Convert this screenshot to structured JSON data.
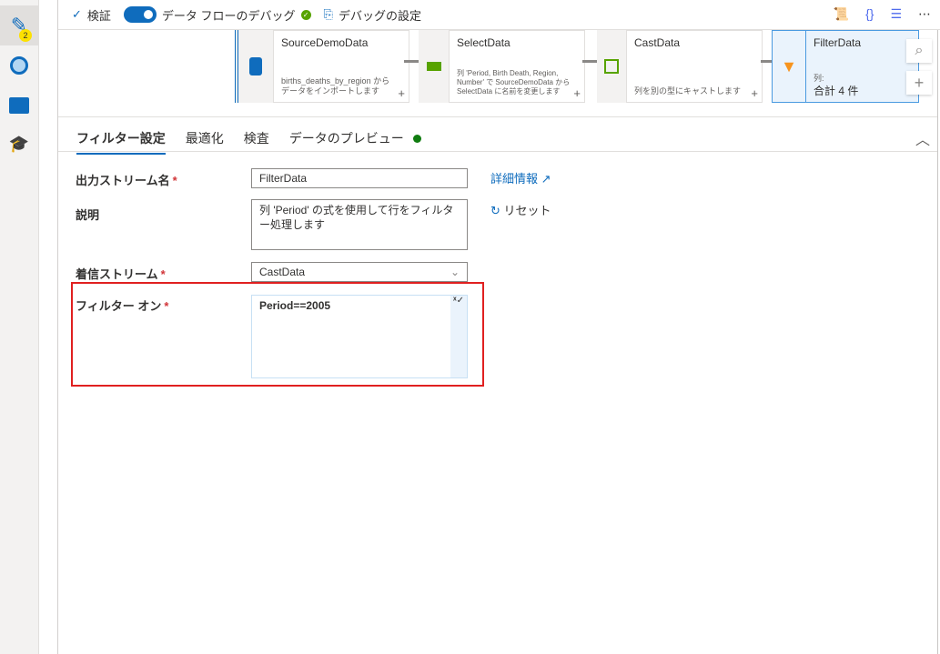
{
  "sidebar": {
    "items": [
      {
        "name": "author",
        "badge": "2"
      },
      {
        "name": "monitor"
      },
      {
        "name": "manage"
      },
      {
        "name": "learn"
      }
    ]
  },
  "toolbar": {
    "validate": "検証",
    "debug_label": "データ フローのデバッグ",
    "debug_on": true,
    "debug_settings": "デバッグの設定"
  },
  "nodes": [
    {
      "title": "SourceDemoData",
      "desc": "births_deaths_by_region からデータをインポートします"
    },
    {
      "title": "SelectData",
      "desc": "列 'Period, Birth Death, Region, Number' で SourceDemoData から SelectData に名前を変更します"
    },
    {
      "title": "CastData",
      "desc": "列を別の型にキャストします"
    },
    {
      "title": "FilterData",
      "desc_label": "列:",
      "desc": "合計 4 件"
    }
  ],
  "tabs": [
    "フィルター設定",
    "最適化",
    "検査",
    "データのプレビュー"
  ],
  "form": {
    "output_label": "出力ストリーム名",
    "output_value": "FilterData",
    "desc_label": "説明",
    "desc_value": "列 'Period' の式を使用して行をフィルター処理します",
    "incoming_label": "着信ストリーム",
    "incoming_value": "CastData",
    "filter_label": "フィルター オン",
    "filter_value": "Period==2005",
    "required": "*",
    "learn_more": "詳細情報",
    "reset": "リセット"
  },
  "colors": {
    "accent": "#0f6cbd",
    "highlight": "#e02020",
    "success": "#57a300"
  }
}
